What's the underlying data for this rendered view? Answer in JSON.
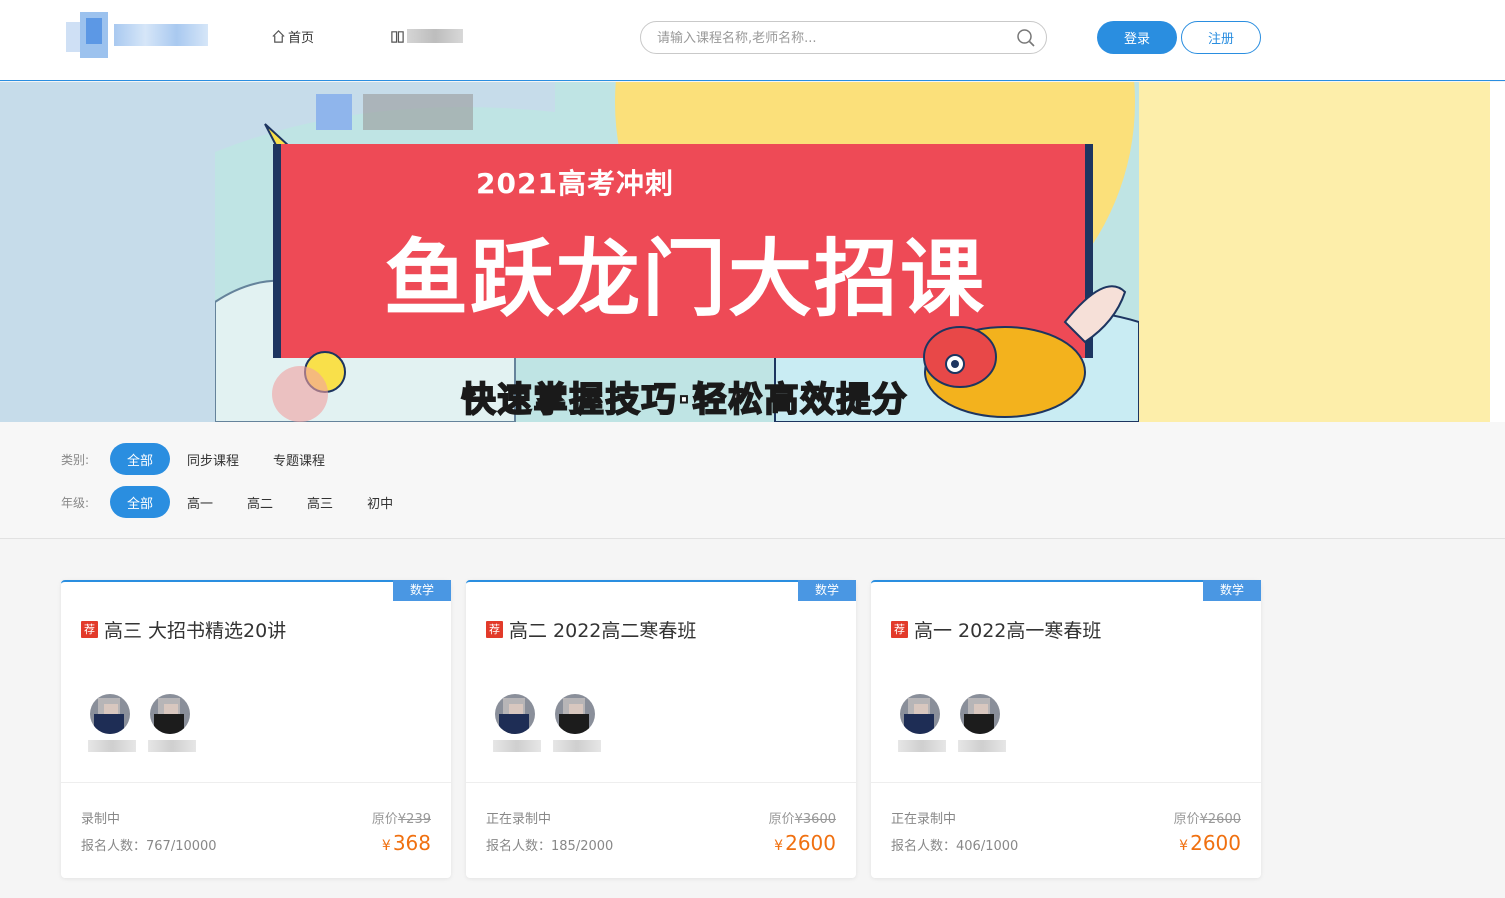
{
  "header": {
    "nav_home": "首页",
    "search_placeholder": "请输入课程名称,老师名称...",
    "login": "登录",
    "register": "注册"
  },
  "banner": {
    "year_line": "2021高考冲刺",
    "main_line": "鱼跃龙门大招课",
    "sub_line": "快速掌握技巧·轻松高效提分"
  },
  "filters": {
    "category_label": "类别:",
    "categories": [
      "全部",
      "同步课程",
      "专题课程"
    ],
    "grade_label": "年级:",
    "grades": [
      "全部",
      "高一",
      "高二",
      "高三",
      "初中"
    ]
  },
  "cards": [
    {
      "subject": "数学",
      "rec": "荐",
      "title": "高三 大招书精选20讲",
      "status": "录制中",
      "enroll": "报名人数：767/10000",
      "orig_label": "原价",
      "orig_price": "¥239",
      "yen": "¥",
      "price": "368"
    },
    {
      "subject": "数学",
      "rec": "荐",
      "title": "高二 2022高二寒春班",
      "status": "正在录制中",
      "enroll": "报名人数：185/2000",
      "orig_label": "原价",
      "orig_price": "¥3600",
      "yen": "¥",
      "price": "2600"
    },
    {
      "subject": "数学",
      "rec": "荐",
      "title": "高一 2022高一寒春班",
      "status": "正在录制中",
      "enroll": "报名人数：406/1000",
      "orig_label": "原价",
      "orig_price": "¥2600",
      "yen": "¥",
      "price": "2600"
    }
  ],
  "colors": {
    "accent": "#2a8ee0",
    "price": "#f07010",
    "banner_red": "#ee4a56"
  }
}
